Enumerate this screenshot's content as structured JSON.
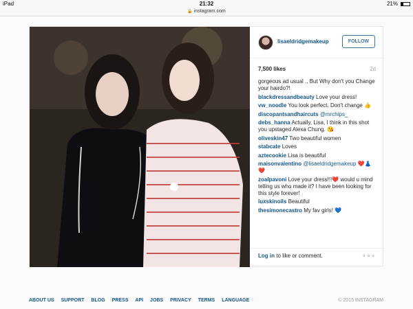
{
  "status": {
    "device": "iPad",
    "time": "21:32",
    "battery": "21%"
  },
  "browser": {
    "url": "instagram.com"
  },
  "post": {
    "username": "lisaeldridgemakeup",
    "follow_label": "FOLLOW",
    "likes": "7,500 likes",
    "age": "2d",
    "comments": [
      {
        "user": "",
        "text": "gorgeous ad usual .. But Why don't you Change your hairdo?!"
      },
      {
        "user": "blackdressandbeauty",
        "text": "Love your dress!"
      },
      {
        "user": "vw_noodle",
        "text": "You look perfect. Don't change 👍"
      },
      {
        "user": "discopantsandhaircuts",
        "mention": "@mrchips_",
        "text": ""
      },
      {
        "user": "debs_hanna",
        "text": "Actually, Lisa, I think in this shot you upstaged Alexa Chung. 😘"
      },
      {
        "user": "oliveskin47",
        "text": "Two beautiful women"
      },
      {
        "user": "stabcate",
        "text": "Loves"
      },
      {
        "user": "aztecookie",
        "text": "Lisa is beautiful"
      },
      {
        "user": "maisonvalentino",
        "mention": "@lisaeldridgemakeup",
        "text": "❤️👗❤️"
      },
      {
        "user": "zoalpavoni",
        "text": "Love your dress!!!❤️ would u mind telling us who made it? I have been looking for this style forever!"
      },
      {
        "user": "luxskinoils",
        "text": "Beautiful"
      },
      {
        "user": "thesimonecastro",
        "text": "My fav girls! 💙"
      }
    ],
    "login_link": "Log in",
    "login_rest": " to like or comment.",
    "more": "∘∘∘"
  },
  "footer": {
    "links": [
      "ABOUT US",
      "SUPPORT",
      "BLOG",
      "PRESS",
      "API",
      "JOBS",
      "PRIVACY",
      "TERMS",
      "LANGUAGE"
    ],
    "copyright": "© 2015 INSTAGRAM"
  }
}
